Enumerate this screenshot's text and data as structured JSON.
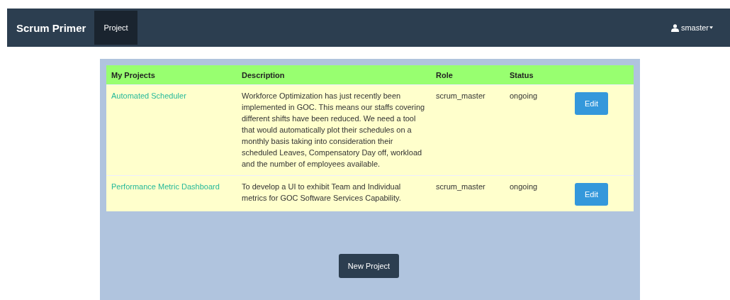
{
  "navbar": {
    "brand": "Scrum Primer",
    "tabs": [
      {
        "label": "Project",
        "selected": true
      }
    ],
    "user": "smaster"
  },
  "table": {
    "columns": [
      "My Projects",
      "Description",
      "Role",
      "Status"
    ],
    "rows": [
      {
        "name": "Automated Scheduler",
        "description": "Workforce Optimization has just recently been implemented in GOC. This means our staffs covering different shifts have been reduced. We need a tool that would automatically plot their schedules on a monthly basis taking into consideration their scheduled Leaves, Compensatory Day off, workload and the number of employees available.",
        "role": "scrum_master",
        "status": "ongoing",
        "action": "Edit"
      },
      {
        "name": "Performance Metric Dashboard",
        "description": "To develop a UI to exhibit Team and Individual metrics for GOC Software Services Capability.",
        "role": "scrum_master",
        "status": "ongoing",
        "action": "Edit"
      }
    ]
  },
  "new_button": "New Project"
}
